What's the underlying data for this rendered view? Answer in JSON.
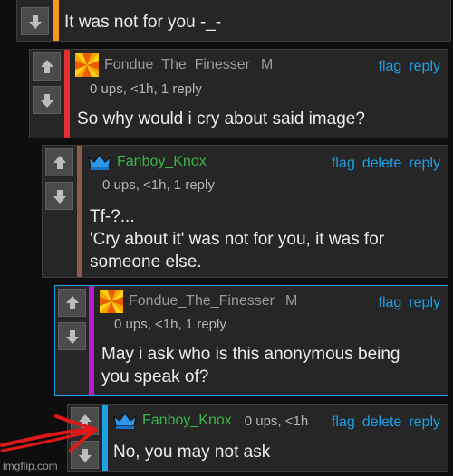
{
  "colors": {
    "bg": "#0e0e0e",
    "card": "#262626",
    "link": "#1ea0e6",
    "user_gold": "#9a9a9a",
    "user_green": "#3cb54a",
    "accent_orange": "#f59a1e",
    "accent_red": "#e03030",
    "accent_brown": "#8b5a4a",
    "accent_purple": "#b31ec9",
    "accent_blue": "#1ea0e6"
  },
  "comments": [
    {
      "body": "It was not for you -_-"
    },
    {
      "username": "Fondue_The_Finesser",
      "mod_badge": "M",
      "meta": "0 ups, <1h, 1 reply",
      "actions": [
        "flag",
        "reply"
      ],
      "body": "So why would i cry about said image?",
      "avatar_icon": "pinwheel-avatar"
    },
    {
      "username": "Fanboy_Knox",
      "meta": "0 ups, <1h, 1 reply",
      "actions": [
        "flag",
        "delete",
        "reply"
      ],
      "body": "Tf-?...\n'Cry about it' was not for you, it was for\nsomeone else.",
      "avatar_icon": "crown-avatar"
    },
    {
      "username": "Fondue_The_Finesser",
      "mod_badge": "M",
      "meta": "0 ups, <1h, 1 reply",
      "actions": [
        "flag",
        "reply"
      ],
      "body": "May i ask who is this anonymous being\nyou speak of?",
      "avatar_icon": "pinwheel-avatar"
    },
    {
      "username": "Fanboy_Knox",
      "meta": "0 ups, <1h",
      "actions": [
        "flag",
        "delete",
        "reply"
      ],
      "body": "No, you may not ask",
      "avatar_icon": "crown-avatar"
    }
  ],
  "watermark": "imgflip.com"
}
